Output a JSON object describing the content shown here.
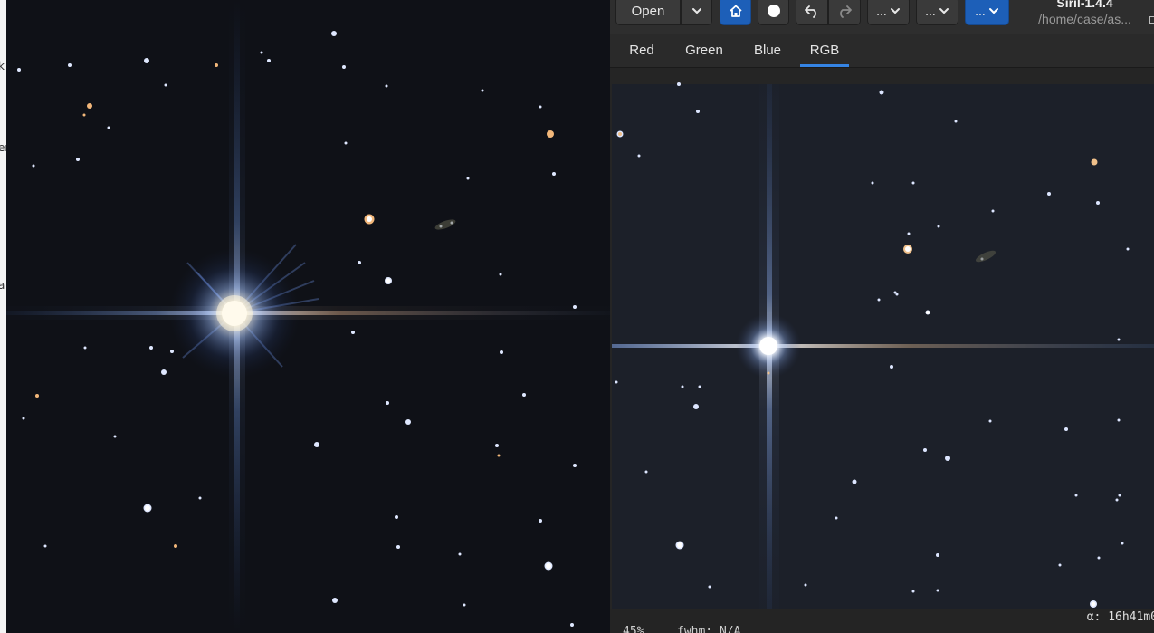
{
  "background_window": {
    "fragments": [
      "k",
      "er",
      "a"
    ]
  },
  "toolbar": {
    "open_label": "Open",
    "menu_label_1": "...",
    "menu_label_2": "...",
    "menu_label_3": "...",
    "accent_color": "#1d5fb8"
  },
  "window": {
    "title": "Siril-1.4.4",
    "subtitle": "/home/case/as..."
  },
  "tabs": [
    {
      "label": "Red",
      "active": false
    },
    {
      "label": "Green",
      "active": false
    },
    {
      "label": "Blue",
      "active": false
    },
    {
      "label": "RGB",
      "active": true
    }
  ],
  "status": {
    "coordinate": "α: 16h41m0",
    "zoom": "45%",
    "fwhm": "fwhm: N/A"
  },
  "icons": {
    "home": "home-icon",
    "record": "circle-icon",
    "undo": "undo-icon",
    "redo": "redo-icon",
    "dropdown": "chevron-down-icon"
  }
}
